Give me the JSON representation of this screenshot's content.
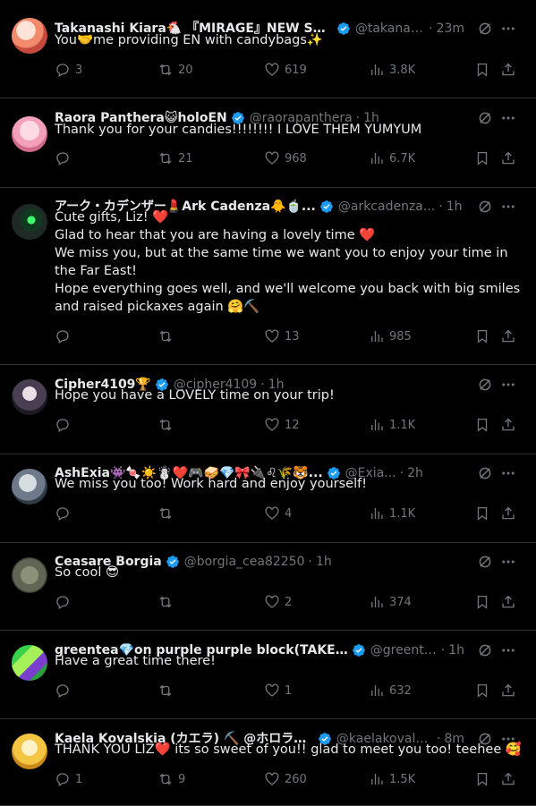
{
  "colors": {
    "background": "#000000",
    "text": "#e7e9ea",
    "muted": "#71767b",
    "verified": "#1d9bf0",
    "heart": "#f91880",
    "divider": "#2f3336"
  },
  "posts": [
    {
      "name": "Takanashi Kiara🐔 『MIRAGE』NEW SON...",
      "handle": "@takanas...",
      "dot": "·",
      "time": "23m",
      "text": [
        "You🤝me providing EN with candybags✨"
      ],
      "replies": "3",
      "reposts": "20",
      "likes": "619",
      "views": "3.8K"
    },
    {
      "name": "Raora Panthera😺holoEN",
      "handle": "@raorapanthera",
      "dot": "·",
      "time": "1h",
      "text": [
        "Thank you for your candies!!!!!!!! I LOVE THEM YUMYUM"
      ],
      "replies": "",
      "reposts": "21",
      "likes": "968",
      "views": "6.7K"
    },
    {
      "name": "アーク・カデンザー💄Ark Cadenza🐥🍵...",
      "handle": "@arkcadenza...",
      "dot": "·",
      "time": "1h",
      "text": [
        "Cute gifts, Liz! ❤️",
        "Glad to hear that you are having a lovely time ❤️",
        "We miss you, but at the same time we want you to enjoy your time in the Far East!",
        "Hope everything goes well, and we'll welcome you back with big smiles and raised pickaxes again 🤗⛏️"
      ],
      "replies": "",
      "reposts": "",
      "likes": "13",
      "views": "985"
    },
    {
      "name": "Cipher4109🏆",
      "handle": "@cipher4109",
      "dot": "·",
      "time": "1h",
      "text": [
        "Hope you have a LOVELY time on your trip!"
      ],
      "replies": "",
      "reposts": "",
      "likes": "12",
      "views": "1.1K"
    },
    {
      "name": "AshExia👾🍬☀️☃️❤️🎮🥪💎🎀🔌♌🌾🐯...",
      "handle": "@Exia...",
      "dot": "·",
      "time": "2h",
      "text": [
        "We miss you too! Work hard and enjoy yourself!"
      ],
      "replies": "",
      "reposts": "",
      "likes": "4",
      "views": "1.1K"
    },
    {
      "name": "Ceasare Borgia",
      "handle": "@borgia_cea82250",
      "dot": "·",
      "time": "1h",
      "text": [
        "So cool 😎"
      ],
      "replies": "",
      "reposts": "",
      "likes": "2",
      "views": "374"
    },
    {
      "name": "greentea💎on purple purple block(TAKE 2 L...",
      "handle": "@greente...",
      "dot": "·",
      "time": "1h",
      "text": [
        "Have a great time there!"
      ],
      "replies": "",
      "reposts": "",
      "likes": "1",
      "views": "632"
    },
    {
      "name": "Kaela Kovalskia (カエラ) ⛏️ @ホロライブID",
      "handle": "@kaelakovalskia",
      "dot": "·",
      "time": "8m",
      "text": [
        "THANK YOU LIZ❤️ its so sweet of you!! glad to meet you too! teehee 🥰"
      ],
      "replies": "1",
      "reposts": "9",
      "likes": "260",
      "views": "1.5K"
    }
  ]
}
